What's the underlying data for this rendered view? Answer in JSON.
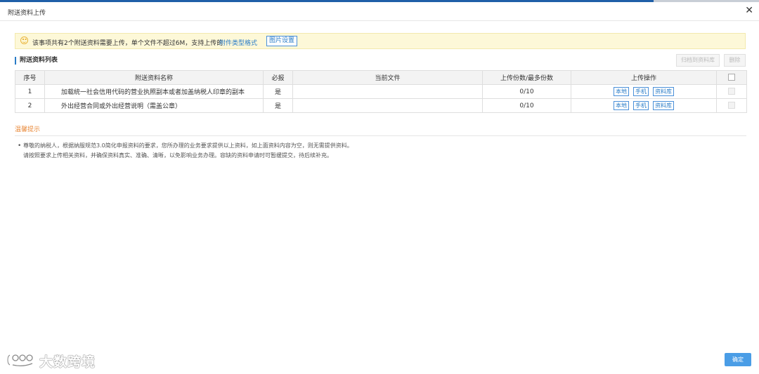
{
  "dialog": {
    "title": "附送资料上传",
    "close_glyph": "✕"
  },
  "notice": {
    "text": "该事项共有2个附送资料需要上传，单个文件不超过6M，支持上传的",
    "link": "附件类型格式",
    "button": "图片设置"
  },
  "section": {
    "title": "附送资料列表",
    "archive_button": "归档到资料库",
    "delete_button": "删除"
  },
  "table": {
    "headers": [
      "序号",
      "附送资料名称",
      "必报",
      "当前文件",
      "上传份数/最多份数",
      "上传操作"
    ],
    "rows": [
      {
        "index": "1",
        "name": "加载统一社会信用代码的营业执照副本或者加盖纳税人印章的副本",
        "required": "是",
        "current_file": "",
        "count": "0/10"
      },
      {
        "index": "2",
        "name": "外出经营合同或外出经营说明（需盖公章）",
        "required": "是",
        "current_file": "",
        "count": "0/10"
      }
    ],
    "op_buttons": [
      "本地",
      "手机",
      "资料库"
    ]
  },
  "tips": {
    "title": "温馨提示",
    "bullet": "•",
    "lines": [
      "尊敬的纳税人，根据纳服规范3.0简化申报资料的要求，您所办理的业务要求提供以上资料，如上面资料内容为空，则无需提供资料。",
      "请按照要求上传相关资料，并确保资料真实、准确、清晰，以免影响业务办理。容缺的资料申请时可暂缓提交，待后续补充。"
    ]
  },
  "watermark": {
    "text": "大数跨境"
  },
  "footer": {
    "confirm": "确定"
  },
  "colors": {
    "accent": "#2a7cc7",
    "notice_bg": "#fdf8d8",
    "tips_title": "#e9893a",
    "confirm_bg": "#4a9de6"
  }
}
